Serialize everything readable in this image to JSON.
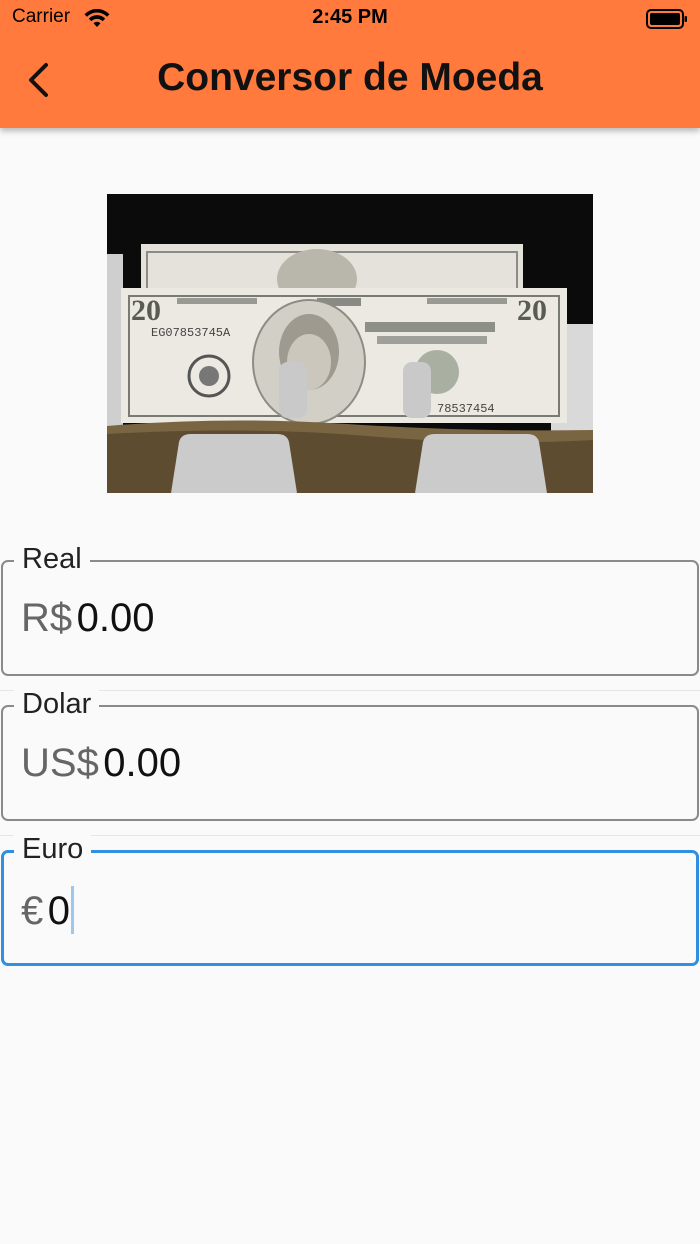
{
  "status_bar": {
    "carrier": "Carrier",
    "time": "2:45 PM"
  },
  "app_bar": {
    "title": "Conversor de Moeda",
    "color": "#ff7a3c"
  },
  "icons": {
    "back": "back-arrow-icon",
    "wifi": "wifi-icon",
    "battery": "battery-icon"
  },
  "fields": [
    {
      "label": "Real",
      "prefix": "R$",
      "value": "0.00"
    },
    {
      "label": "Dolar",
      "prefix": "US$",
      "value": "0.00"
    },
    {
      "label": "Euro",
      "prefix": "€",
      "value": "0"
    }
  ],
  "focus_color": "#2f8fe0"
}
